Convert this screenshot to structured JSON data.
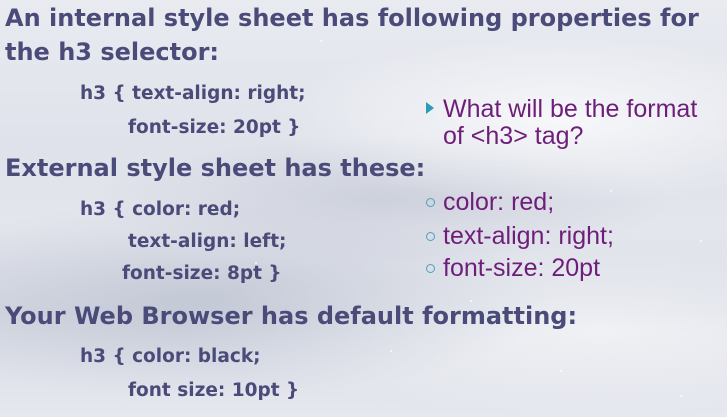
{
  "headings": {
    "internal_line1": "An internal style sheet has following properties for",
    "internal_line2": "the h3 selector:",
    "external": "External style sheet has these:",
    "browser": "Your Web Browser has default formatting:"
  },
  "code": {
    "internal": [
      "h3 { text-align: right;",
      "font-size: 20pt }"
    ],
    "external": [
      "h3 { color: red;",
      "text-align: left;",
      "font-size: 8pt }"
    ],
    "browser": [
      "h3 { color: black;",
      "font size: 10pt }"
    ]
  },
  "question": {
    "line1": "What will be the format",
    "line2": "of <h3> tag?"
  },
  "answers": [
    "color: red;",
    "text-align: right;",
    "font-size: 20pt"
  ],
  "colors": {
    "heading": "#4b4b7a",
    "question_text": "#6e1e7a",
    "bullet": "#2c9bb8"
  },
  "icons": {
    "question_bullet": "triangle-bullet-icon",
    "answer_bullet": "circle-bullet-icon"
  }
}
